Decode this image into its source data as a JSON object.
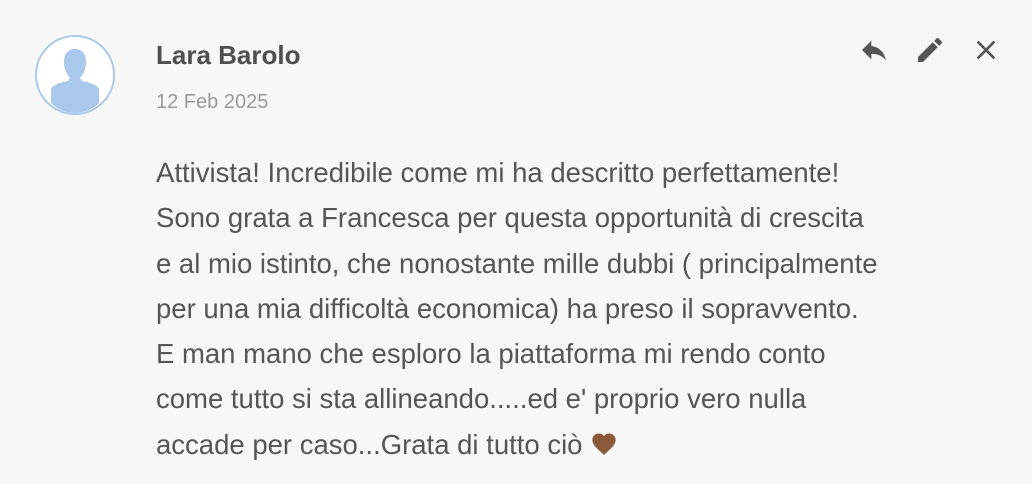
{
  "comment": {
    "author": "Lara Barolo",
    "date": "12 Feb 2025",
    "text_lines": [
      "Attivista! Incredibile come mi ha descritto perfettamente!",
      "Sono grata a Francesca per questa opportunità di crescita",
      "e al mio istinto, che nonostante mille dubbi ( principalmente",
      "per una mia difficoltà economica) ha preso il sopravvento.",
      "E man mano che esploro la piattaforma mi rendo conto",
      "come tutto si sta allineando.....ed e' proprio vero nulla",
      "accade per caso...Grata di tutto ciò"
    ],
    "trailing_emoji": "brown-heart-icon"
  },
  "actions": [
    {
      "name": "reply-icon"
    },
    {
      "name": "edit-icon"
    },
    {
      "name": "close-icon"
    }
  ],
  "colors": {
    "background": "#f7f7f7",
    "avatar_fill": "#aac8ec",
    "heart": "#8a5a3b",
    "icon": "#555555"
  }
}
